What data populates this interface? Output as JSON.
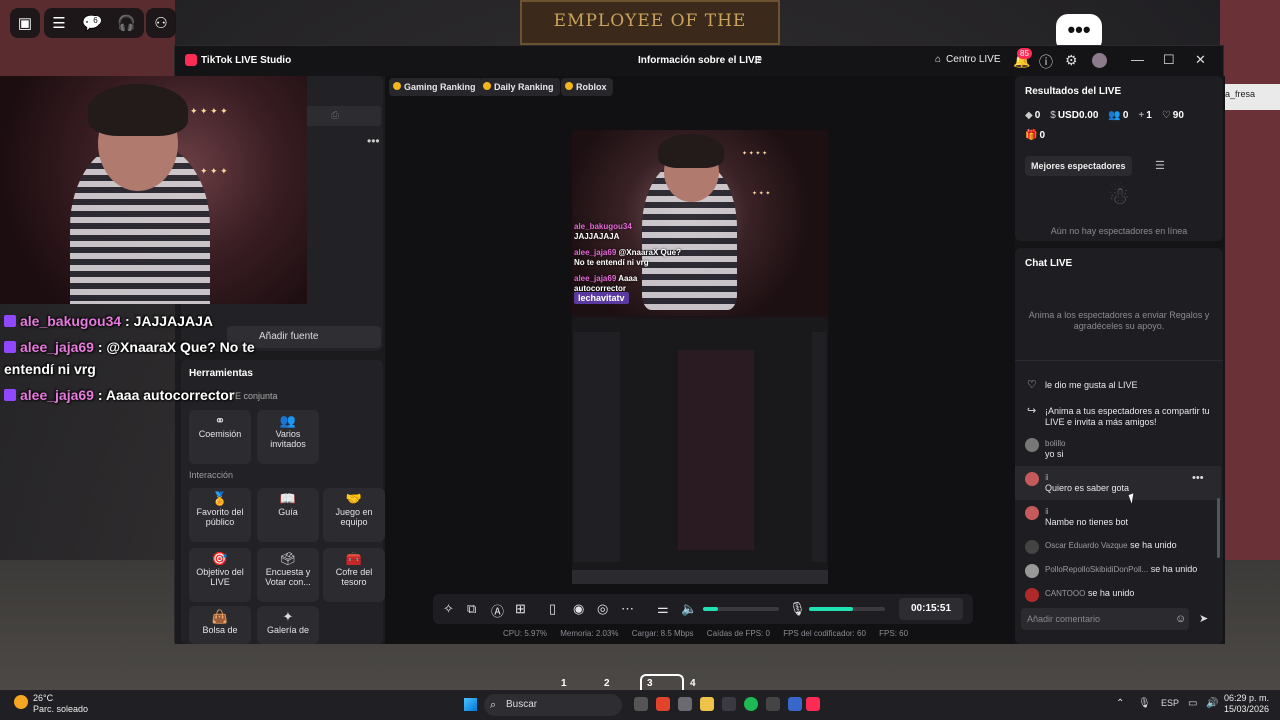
{
  "game": {
    "board_text": "EMPLOYEE OF THE MONTH",
    "chat_badge": "6",
    "side_label": "a_fresa",
    "chat_button": "•••"
  },
  "window": {
    "app_title": "TikTok LIVE Studio",
    "center_title": "Información sobre el LIVE",
    "centro_live": "Centro LIVE",
    "notif_count": "85"
  },
  "left": {
    "add_source": "Añadir fuente",
    "tools_title": "Herramientas",
    "tools_sub": "VE conjunta",
    "section_interaction": "Interacción",
    "tools": [
      {
        "label": "Coemisión",
        "icon": "⚭"
      },
      {
        "label": "Varios invitados",
        "icon": "👥"
      },
      {
        "label": "Favorito del público",
        "icon": "🏅"
      },
      {
        "label": "Guía",
        "icon": "📖"
      },
      {
        "label": "Juego en equipo",
        "icon": "🤝"
      },
      {
        "label": "Objetivo del LIVE",
        "icon": "🎯"
      },
      {
        "label": "Encuesta y Votar con...",
        "icon": "🗳"
      },
      {
        "label": "Cofre del tesoro",
        "icon": "🧰"
      },
      {
        "label": "Bolsa de",
        "icon": "👜"
      },
      {
        "label": "Galería de",
        "icon": "✦"
      }
    ]
  },
  "center": {
    "rankings": [
      "Gaming Ranking",
      "Daily Ranking",
      "Roblox"
    ],
    "preview_chat": [
      {
        "user": "ale_bakugou34",
        "text": "JAJJAJAJA"
      },
      {
        "user": "alee_jaja69",
        "text": "@XnaaraX Que? No te entendí ni vrg"
      },
      {
        "user": "alee_jaja69",
        "text": "Aaaa autocorrector"
      }
    ],
    "preview_tag": "lechavitatv",
    "timer": "00:15:51",
    "mic_level": 0.58,
    "audio_level": 0.2,
    "stats": {
      "cpu": "CPU: 5.97%",
      "memory": "Memoria: 2.03%",
      "upload": "Cargar: 8.5 Mbps",
      "fps_drops": "Caídas de FPS: 0",
      "encoder_fps": "FPS del codificador: 60",
      "fps": "FPS: 60"
    }
  },
  "right": {
    "results_title": "Resultados del LIVE",
    "diamonds": "0",
    "usd": "USD0.00",
    "viewers": "0",
    "followers": "1",
    "likes": "90",
    "gifts": "0",
    "best_viewers": "Mejores espectadores",
    "no_viewers": "Aún no hay espectadores en línea",
    "chat_title": "Chat LIVE",
    "chat_hint": "Anima a los espectadores a enviar Regalos y agradéceles su apoyo.",
    "messages": [
      {
        "user": "",
        "text": "le dio me gusta al LIVE",
        "kind": "like"
      },
      {
        "user": "",
        "text": "¡Anima a tus espectadores a compartir tu LIVE e invita a más amigos!",
        "kind": "share"
      },
      {
        "user": "bolillo",
        "text": "yo si",
        "kind": "comment"
      },
      {
        "user": "",
        "text": "Quiero es saber gota",
        "kind": "comment"
      },
      {
        "user": "",
        "text": "Nambe no tienes bot",
        "kind": "comment"
      },
      {
        "user": "Oscar Eduardo Vazque",
        "text": "se ha unido",
        "kind": "join"
      },
      {
        "user": "PolloRepolloSkibidiDonPoll...",
        "text": "se ha unido",
        "kind": "join"
      },
      {
        "user": "CANTOOO",
        "text": "se ha unido",
        "kind": "join"
      }
    ],
    "comment_placeholder": "Añadir comentario"
  },
  "overlay_chat": [
    {
      "user": "ale_bakugou34",
      "text": " : JAJJAJAJA"
    },
    {
      "user": "alee_jaja69",
      "text": " : @XnaaraX Que? No te"
    },
    {
      "user": "",
      "text": "entendí ni vrg"
    },
    {
      "user": "alee_jaja69",
      "text": " : Aaaa autocorrector"
    }
  ],
  "taskbar": {
    "temp": "26°C",
    "weather": "Parc. soleado",
    "search": "Buscar",
    "lang": "ESP",
    "time": "06:29 p. m.",
    "date": "15/03/2026",
    "workspaces": [
      "1",
      "2",
      "3",
      "4"
    ]
  }
}
